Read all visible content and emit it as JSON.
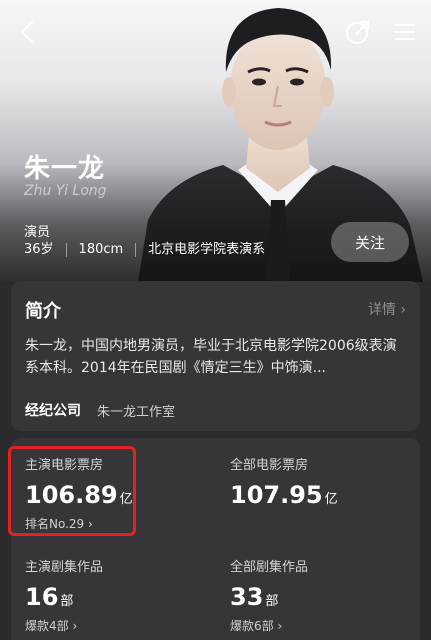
{
  "header": {
    "name": "朱一龙",
    "name_en": "Zhu Yi Long",
    "role": "演员",
    "tags": [
      "36岁",
      "180cm",
      "北京电影学院表演系"
    ],
    "follow_label": "关注",
    "icons": [
      "back-icon",
      "share-icon",
      "menu-icon"
    ]
  },
  "intro": {
    "title": "简介",
    "more": "详情 ›",
    "text": "朱一龙，中国内地男演员，毕业于北京电影学院2006级表演系本科。2014年在民国剧《情定三生》中饰演...",
    "company_label": "经纪公司",
    "company_value": "朱一龙工作室"
  },
  "stats": {
    "lead_box_office_label": "主演电影票房",
    "lead_box_office_value": "106.89",
    "lead_box_office_unit": "亿",
    "lead_box_office_rank": "排名No.29 ›",
    "total_box_office_label": "全部电影票房",
    "total_box_office_value": "107.95",
    "total_box_office_unit": "亿",
    "lead_series_label": "主演剧集作品",
    "lead_series_value": "16",
    "lead_series_unit": "部",
    "lead_series_sub": "爆款4部 ›",
    "total_series_label": "全部剧集作品",
    "total_series_value": "33",
    "total_series_unit": "部",
    "total_series_sub": "爆款6部 ›"
  },
  "colors": {
    "highlight": "#e52222",
    "card_bg": "#363638",
    "page_bg": "#2b2b2d"
  }
}
